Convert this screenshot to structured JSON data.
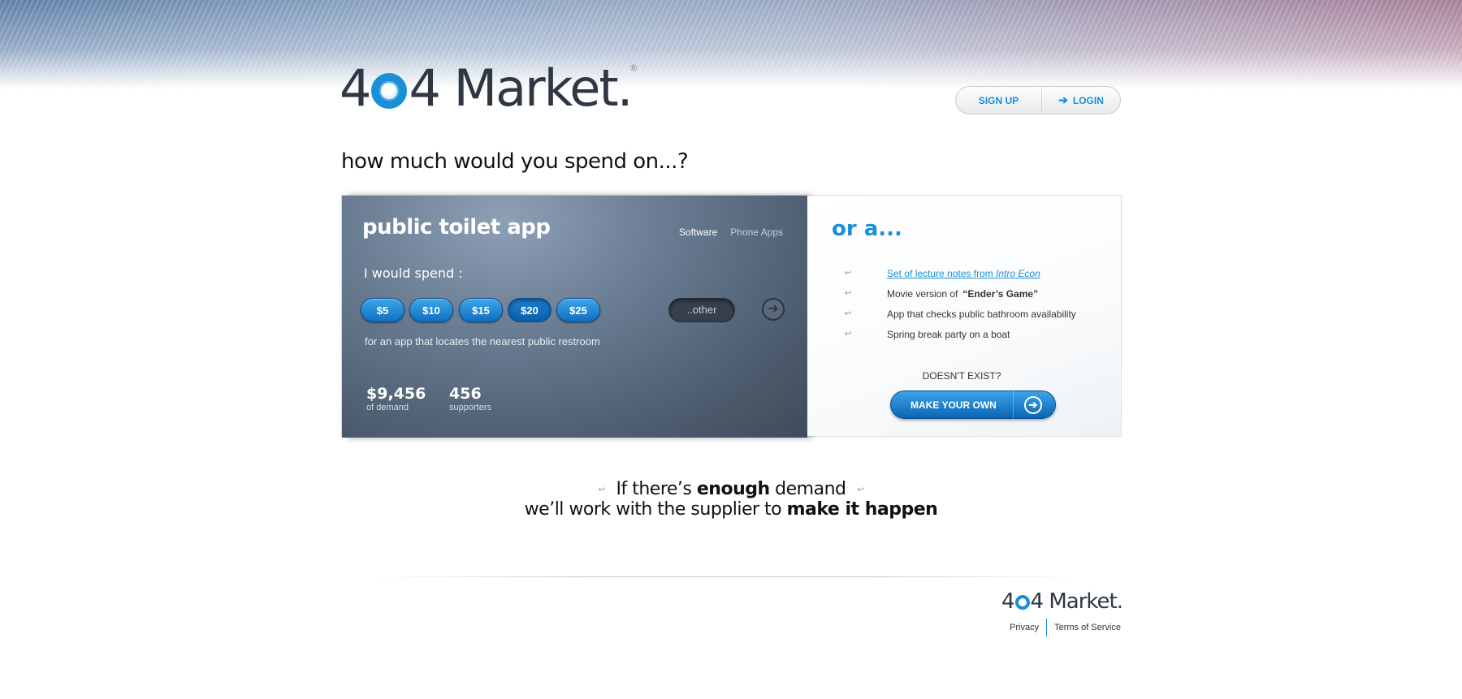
{
  "brand": {
    "logo_prefix": "4",
    "logo_suffix": "4 Market.",
    "registered": "®"
  },
  "auth": {
    "signup_label": "SIGN UP",
    "login_label": "LOGIN",
    "login_icon": "arrow-right-icon"
  },
  "question": "how much would you spend on...?",
  "featured": {
    "title": "public toilet app",
    "categories": [
      "Software",
      "Phone Apps"
    ],
    "active_category": "Software",
    "spend_label": "I would spend :",
    "amounts": [
      "$5",
      "$10",
      "$15",
      "$20",
      "$25"
    ],
    "selected_amount": "$20",
    "other_placeholder": "..other",
    "description": "for an app that locates the nearest public restroom",
    "demand": {
      "value": "$9,456",
      "label": "of demand"
    },
    "supporters": {
      "value": "456",
      "label": "supporters"
    }
  },
  "alternatives": {
    "heading": "or a...",
    "items": [
      {
        "text": "Set of lecture notes from ",
        "emph": "Intro Econ",
        "link": true
      },
      {
        "text": "Movie version of",
        "emph": "“Ender’s Game”",
        "link": false
      },
      {
        "text": "App that checks public bathroom availability",
        "emph": "",
        "link": false
      },
      {
        "text": "Spring break party on a boat",
        "emph": "",
        "link": false
      }
    ],
    "doesnt_exist": "DOESN'T EXIST?",
    "make_own": "MAKE YOUR OWN"
  },
  "tagline": {
    "line1_a": "If there’s ",
    "line1_b": "enough",
    "line1_c": " demand",
    "line2_a": "we’ll work with the supplier to ",
    "line2_b": "make it happen"
  },
  "footer": {
    "privacy": "Privacy",
    "terms": "Terms of Service"
  },
  "colors": {
    "accent": "#1a8fd8",
    "dark_panel": "#4d5c6e"
  }
}
